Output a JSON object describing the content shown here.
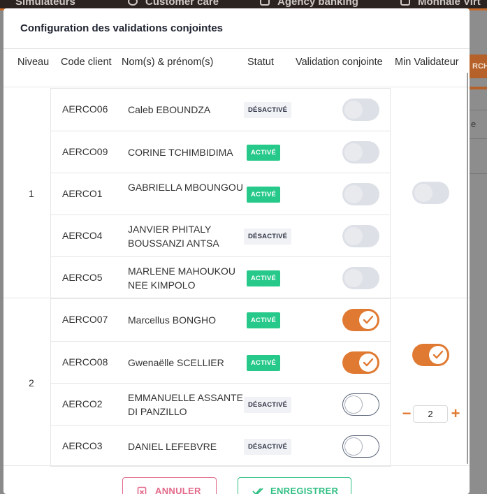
{
  "background": {
    "nav_items": [
      "Simulateurs",
      "Customer care",
      "Agency banking",
      "Monnaie Virt"
    ],
    "search_label": "RCHE",
    "cell_letter": "e"
  },
  "modal": {
    "title": "Configuration des validations conjointes",
    "headers": {
      "level": "Niveau",
      "code": "Code client",
      "name": "Nom(s) & prénom(s)",
      "status": "Statut",
      "joint": "Validation conjointe",
      "min": "Min Validateur"
    },
    "groups": [
      {
        "level": "1",
        "min_validator_enabled": false,
        "rows": [
          {
            "code": "AERCO06",
            "name": "Caleb EBOUNDZA",
            "status": "DÉSACTIVÉ",
            "joint": false
          },
          {
            "code": "AERCO09",
            "name": "CORINE TCHIMBIDIMA",
            "status": "ACTIVÉ",
            "joint": false
          },
          {
            "code": "AERCO1",
            "name": "GABRIELLA MBOUNGOU",
            "status": "ACTIVÉ",
            "joint": false
          },
          {
            "code": "AERCO4",
            "name": "JANVIER PHITALY BOUSSANZI ANTSA",
            "status": "DÉSACTIVÉ",
            "joint": false
          },
          {
            "code": "AERCO5",
            "name": "MARLENE MAHOUKOU NEE KIMPOLO",
            "status": "ACTIVÉ",
            "joint": false
          }
        ]
      },
      {
        "level": "2",
        "min_validator_enabled": true,
        "min_validator_value": "2",
        "rows": [
          {
            "code": "AERCO07",
            "name": "Marcellus BONGHO",
            "status": "ACTIVÉ",
            "joint": true
          },
          {
            "code": "AERCO08",
            "name": "Gwenaëlle SCELLIER",
            "status": "ACTIVÉ",
            "joint": true
          },
          {
            "code": "AERCO2",
            "name": "EMMANUELLE ASSANTE DI PANZILLO",
            "status": "DÉSACTIVÉ",
            "joint": false
          },
          {
            "code": "AERCO3",
            "name": "DANIEL LEFEBVRE",
            "status": "DÉSACTIVÉ",
            "joint": false
          }
        ]
      }
    ],
    "stepper": {
      "minus": "−",
      "plus": "+"
    },
    "buttons": {
      "cancel": "ANNULER",
      "save": "ENREGISTRER"
    }
  },
  "colors": {
    "accent": "#e07a32",
    "active": "#26c98a",
    "cancel": "#e26a8a",
    "save": "#2fbf83"
  }
}
